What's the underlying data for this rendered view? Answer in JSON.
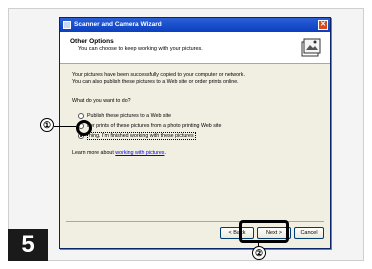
{
  "window": {
    "title": "Scanner and Camera Wizard",
    "close_glyph": "✕"
  },
  "header": {
    "title": "Other Options",
    "subtitle": "You can choose to keep working with your pictures.",
    "icon": "wizard-art-icon"
  },
  "body": {
    "line1": "Your pictures have been successfully copied to your computer or network.",
    "line2": "You can also publish these pictures to a Web site or order prints online.",
    "question": "What do you want to do?"
  },
  "options": [
    {
      "label": "Publish these pictures to a Web site",
      "selected": false
    },
    {
      "label": "der prints of these pictures from a photo printing Web site",
      "selected": false
    },
    {
      "label": "hing. I'm finished working with these pictures",
      "selected": true
    }
  ],
  "learn": {
    "prefix": "Learn more about ",
    "link": "working with pictures",
    "suffix": "."
  },
  "buttons": {
    "back": "< Back",
    "next": "Next >",
    "cancel": "Cancel"
  },
  "callouts": {
    "one": "①",
    "two": "②"
  },
  "step": {
    "number": "5"
  }
}
